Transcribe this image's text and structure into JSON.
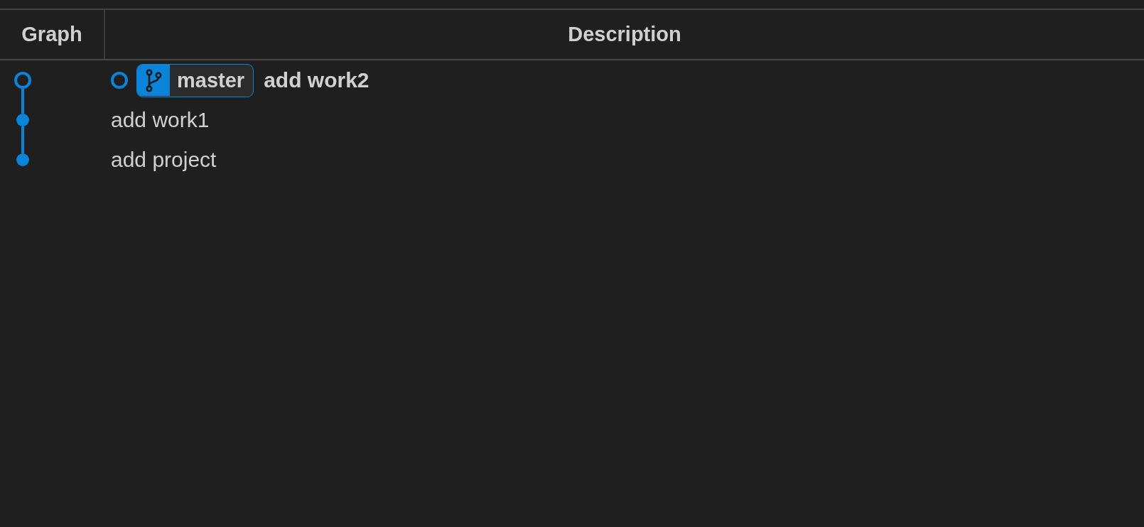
{
  "columns": [
    {
      "label": "Graph"
    },
    {
      "label": "Description"
    }
  ],
  "commits": [
    {
      "message": "add work2",
      "current": true,
      "refs": [
        {
          "kind": "branch",
          "name": "master"
        }
      ]
    },
    {
      "message": "add work1",
      "current": false
    },
    {
      "message": "add project",
      "current": false
    }
  ]
}
